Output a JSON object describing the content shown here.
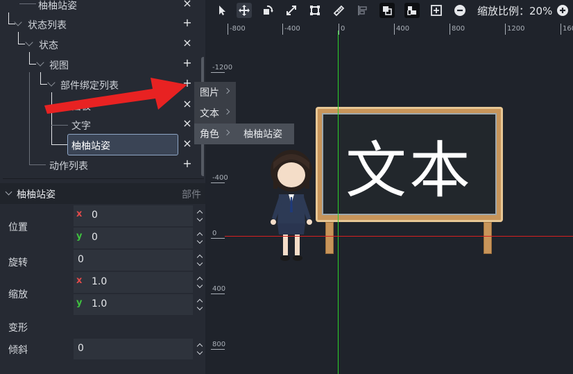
{
  "tree": {
    "rows": [
      {
        "label": "柚柚站姿",
        "action": "×"
      },
      {
        "label": "状态列表",
        "action": "+"
      },
      {
        "label": "状态",
        "action": "×"
      },
      {
        "label": "视图",
        "action": "+"
      },
      {
        "label": "部件绑定列表",
        "action": "+"
      },
      {
        "label": "面板",
        "action": "×"
      },
      {
        "label": "文字",
        "action": "×"
      },
      {
        "label": "柚柚站姿",
        "action": "×"
      },
      {
        "label": "动作列表",
        "action": "+"
      }
    ]
  },
  "props": {
    "header": "柚柚站姿",
    "header_tag": "部件",
    "position_label": "位置",
    "pos_x": "0",
    "pos_y": "0",
    "rotation_label": "旋转",
    "rotation": "0",
    "scale_label": "缩放",
    "scale_x": "1.0",
    "scale_y": "1.0",
    "deform_label": "变形",
    "skew_label": "倾斜",
    "skew": "0",
    "x_axis": "x",
    "y_axis": "y"
  },
  "toolbar": {
    "icons": [
      "pointer-icon",
      "move-icon",
      "rotate-icon",
      "scale-icon",
      "frame-icon",
      "ruler-icon",
      "align-icon",
      "layer-front-icon",
      "layer-back-icon",
      "fit-icon",
      "zoom-out-icon",
      "zoom-in-icon"
    ],
    "zoom_label": "缩放比例：20%"
  },
  "ruler": {
    "top": [
      "-800",
      "-400",
      "0",
      "400",
      "800",
      "1200",
      "160"
    ],
    "left": [
      "-1200",
      "-400",
      "0",
      "400",
      "800"
    ]
  },
  "canvas": {
    "board_text": "文本"
  },
  "context_menu": {
    "items": [
      "图片",
      "文本",
      "角色"
    ],
    "submenu_item": "柚柚站姿"
  },
  "colors": {
    "accent_select": "#8fa6c6",
    "axis_x": "#d82020",
    "axis_y": "#2bd12b",
    "arrow": "#e82222"
  }
}
